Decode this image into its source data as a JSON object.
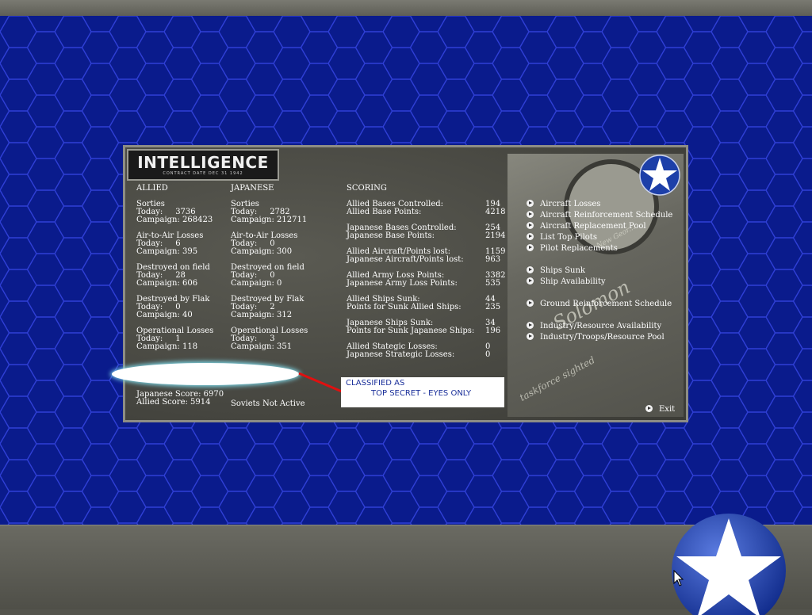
{
  "panel": {
    "title": "INTELLIGENCE",
    "subtitle": "CONTRACT DATE DEC 31 1942"
  },
  "allied": {
    "header": "ALLIED",
    "blocks": [
      {
        "text": "Sorties\nToday:     3736\nCampaign: 268423"
      },
      {
        "text": "Air-to-Air Losses\nToday:     6\nCampaign: 395"
      },
      {
        "text": "Destroyed on field\nToday:     28\nCampaign: 606"
      },
      {
        "text": "Destroyed by Flak\nToday:     0\nCampaign: 40"
      },
      {
        "text": "Operational Losses\nToday:     1\nCampaign: 118"
      }
    ],
    "score": "Japanese Score: 6970\nAllied Score: 5914"
  },
  "japanese": {
    "header": "JAPANESE",
    "blocks": [
      {
        "text": "Sorties\nToday:     2782\nCampaign: 212711"
      },
      {
        "text": "Air-to-Air Losses\nToday:     0\nCampaign: 300"
      },
      {
        "text": "Destroyed on field\nToday:     0\nCampaign: 0"
      },
      {
        "text": "Destroyed by Flak\nToday:     2\nCampaign: 312"
      },
      {
        "text": "Operational Losses\nToday:     3\nCampaign: 351"
      }
    ],
    "soviets": "Soviets Not Active"
  },
  "scoring": {
    "header": "SCORING",
    "rows": [
      {
        "label": "Allied Bases Controlled:\nAllied Base Points:",
        "value": "194\n4218"
      },
      {
        "label": "Japanese Bases Controlled:\nJapanese Base Points:",
        "value": "254\n2194"
      },
      {
        "label": "Allied Aircraft/Points lost:\nJapanese Aircraft/Points lost:",
        "value": "1159\n963"
      },
      {
        "label": "Allied Army Loss Points:\nJapanese Army Loss Points:",
        "value": "3382\n535"
      },
      {
        "label": "Allied Ships Sunk:\nPoints for Sunk Allied Ships:",
        "value": "44\n235"
      },
      {
        "label": "Japanese Ships Sunk:\nPoints for Sunk Japanese Ships:",
        "value": "34\n196"
      },
      {
        "label": "Allied Stategic Losses:\nJapanese Strategic Losses:",
        "value": "0\n0"
      }
    ]
  },
  "menu": [
    "Aircraft Losses",
    "Aircraft Reinforcement Schedule",
    "Aircraft Replacement Pool",
    "List Top Pilots",
    "Pilot Replacements",
    "Ships Sunk",
    "Ship Availability",
    "Ground Reinforcement Schedule",
    "Industry/Resource Availability",
    "Industry/Troops/Resource Pool"
  ],
  "exit_label": "Exit",
  "callout": {
    "line1": "CLASSIFIED AS",
    "line2": "TOP SECRET - EYES ONLY"
  },
  "photo_text": [
    "Solomon",
    "taskforce sighted",
    "New Geor..."
  ],
  "colors": {
    "hex_bg": "#0a1b8c",
    "hex_line": "#2f3fd6",
    "callout_text": "#1a2f9a",
    "annotation_red": "#e01010"
  },
  "icons": [
    "star-roundel-icon",
    "arrow-bullet-icon",
    "mouse-pointer-icon"
  ]
}
